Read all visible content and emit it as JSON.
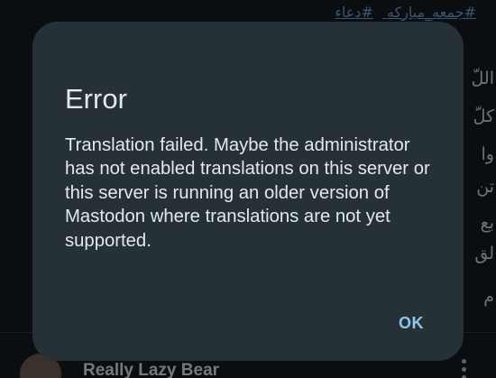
{
  "background_post": {
    "hashtags": [
      "#جمعه_مبارکه",
      "#دعاء"
    ],
    "text_fragments": [
      "اللّ",
      "كلّ",
      "وا",
      "تن",
      "بع",
      "لق",
      "م"
    ],
    "author_name": "Really Lazy Bear"
  },
  "dialog": {
    "title": "Error",
    "message": "Translation failed. Maybe the administrator has not enabled translations on this server or this server is running an older version of Mastodon where translations are not yet supported.",
    "ok_label": "OK"
  },
  "colors": {
    "dialog_background": "#253136",
    "accent": "#8cc8ea",
    "hashtag_link": "#6b9bd0",
    "text": "#e4e8ea"
  },
  "icons": [
    "more-vertical-icon"
  ]
}
